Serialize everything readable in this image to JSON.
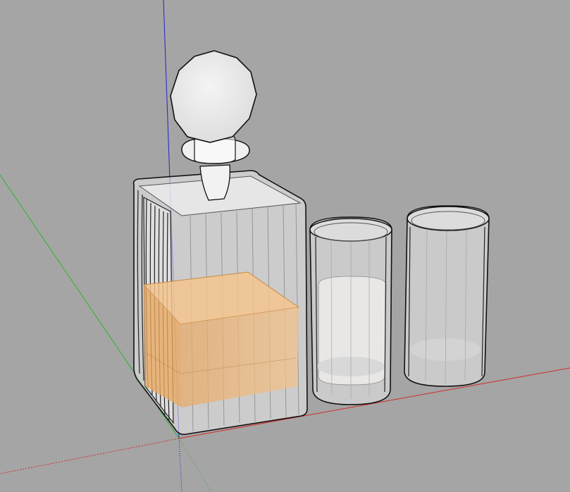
{
  "viewport": {
    "background": "#a5a5a5",
    "axis_colors": {
      "red": "#d12b2b",
      "green": "#2fb22f",
      "blue": "#2323c8"
    }
  },
  "scene": {
    "objects": [
      {
        "name": "decanter",
        "liquid_color": "#f0b673"
      },
      {
        "name": "glass-left"
      },
      {
        "name": "glass-right"
      }
    ],
    "glass_color": "#f2f2f2",
    "edge_color": "#111111"
  }
}
